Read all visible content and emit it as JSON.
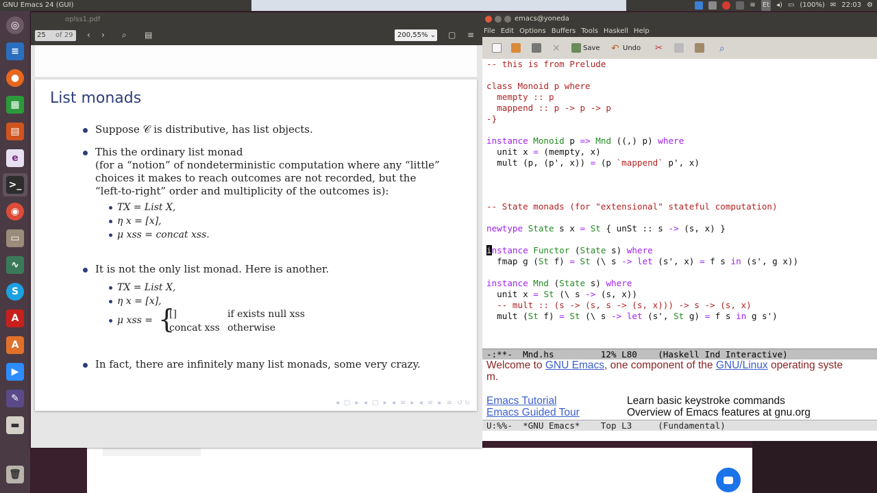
{
  "topbar": {
    "title": "GNU Emacs 24 (GUI)",
    "battery": "(100%)",
    "keyboard": "Et",
    "clock": "22:03"
  },
  "pdf": {
    "window_title": "oplss1.pdf",
    "page_current": "25",
    "page_total": "of 29",
    "zoom": "200,55%",
    "slide": {
      "title": "List monads",
      "b1": "Suppose 𝒞 is distributive, has list objects.",
      "b2_line1": "This the ordinary list monad",
      "b2_line2": "(for a “notion” of nondeterministic computation where any “little”",
      "b2_line3": "choices it makes to reach outcomes are not recorded, but the",
      "b2_line4": "“left-to-right” order and multiplicity of the outcomes is):",
      "s1": "TX = List X,",
      "s2": "η x = [x],",
      "s3": "μ xss = concat xss.",
      "b3": "It is not the only list monad. Here is another.",
      "t1": "TX = List X,",
      "t2": "η x = [x],",
      "t3": "μ xss =",
      "case1_left": "[]",
      "case1_right": "if exists null xss",
      "case2_left": "concat xss",
      "case2_right": "otherwise",
      "b4": "In fact, there are infinitely many list monads, some very crazy."
    }
  },
  "emacs": {
    "window_title": "emacs@yoneda",
    "menu": [
      "File",
      "Edit",
      "Options",
      "Buffers",
      "Tools",
      "Haskell",
      "Help"
    ],
    "toolbar": {
      "save": "Save",
      "undo": "Undo"
    },
    "modeline1": "-:**-  Mnd.hs         12% L80    (Haskell Ind Interactive)",
    "welcome": {
      "line1_pre": "Welcome to ",
      "line1_link1": "GNU Emacs",
      "line1_mid": ", one component of the ",
      "line1_link2": "GNU/Linux",
      "line1_post": " operating syste",
      "line2": "m.",
      "tutorial_link": "Emacs Tutorial",
      "tutorial_desc": "Learn basic keystroke commands",
      "tour_link": "Emacs Guided Tour",
      "tour_desc": "Overview of Emacs features at gnu.org"
    },
    "modeline2": "U:%%-  *GNU Emacs*    Top L3     (Fundamental)"
  }
}
